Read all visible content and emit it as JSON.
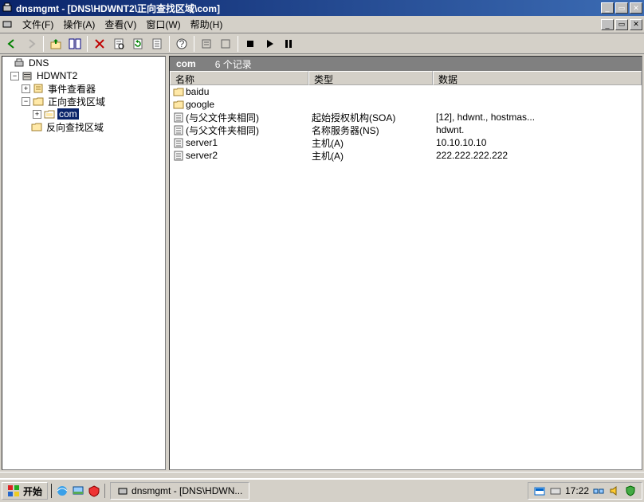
{
  "window": {
    "title": "dnsmgmt - [DNS\\HDWNT2\\正向查找区域\\com]"
  },
  "menu": {
    "file": "文件(F)",
    "action": "操作(A)",
    "view": "查看(V)",
    "window": "窗口(W)",
    "help": "帮助(H)"
  },
  "header": {
    "zone": "com",
    "count": "6 个记录"
  },
  "columns": {
    "name": "名称",
    "type": "类型",
    "data": "数据"
  },
  "tree": {
    "root": "DNS",
    "server": "HDWNT2",
    "event_viewer": "事件查看器",
    "fwd_zone": "正向查找区域",
    "fwd_child": "com",
    "rev_zone": "反向查找区域"
  },
  "records": [
    {
      "icon": "folder",
      "name": "baidu",
      "type": "",
      "data": ""
    },
    {
      "icon": "folder",
      "name": "google",
      "type": "",
      "data": ""
    },
    {
      "icon": "record",
      "name": "(与父文件夹相同)",
      "type": "起始授权机构(SOA)",
      "data": "[12], hdwnt., hostmas..."
    },
    {
      "icon": "record",
      "name": "(与父文件夹相同)",
      "type": "名称服务器(NS)",
      "data": "hdwnt."
    },
    {
      "icon": "record",
      "name": "server1",
      "type": "主机(A)",
      "data": "10.10.10.10"
    },
    {
      "icon": "record",
      "name": "server2",
      "type": "主机(A)",
      "data": "222.222.222.222"
    }
  ],
  "taskbar": {
    "start": "开始",
    "task": "dnsmgmt - [DNS\\HDWN...",
    "time": "17:22"
  }
}
